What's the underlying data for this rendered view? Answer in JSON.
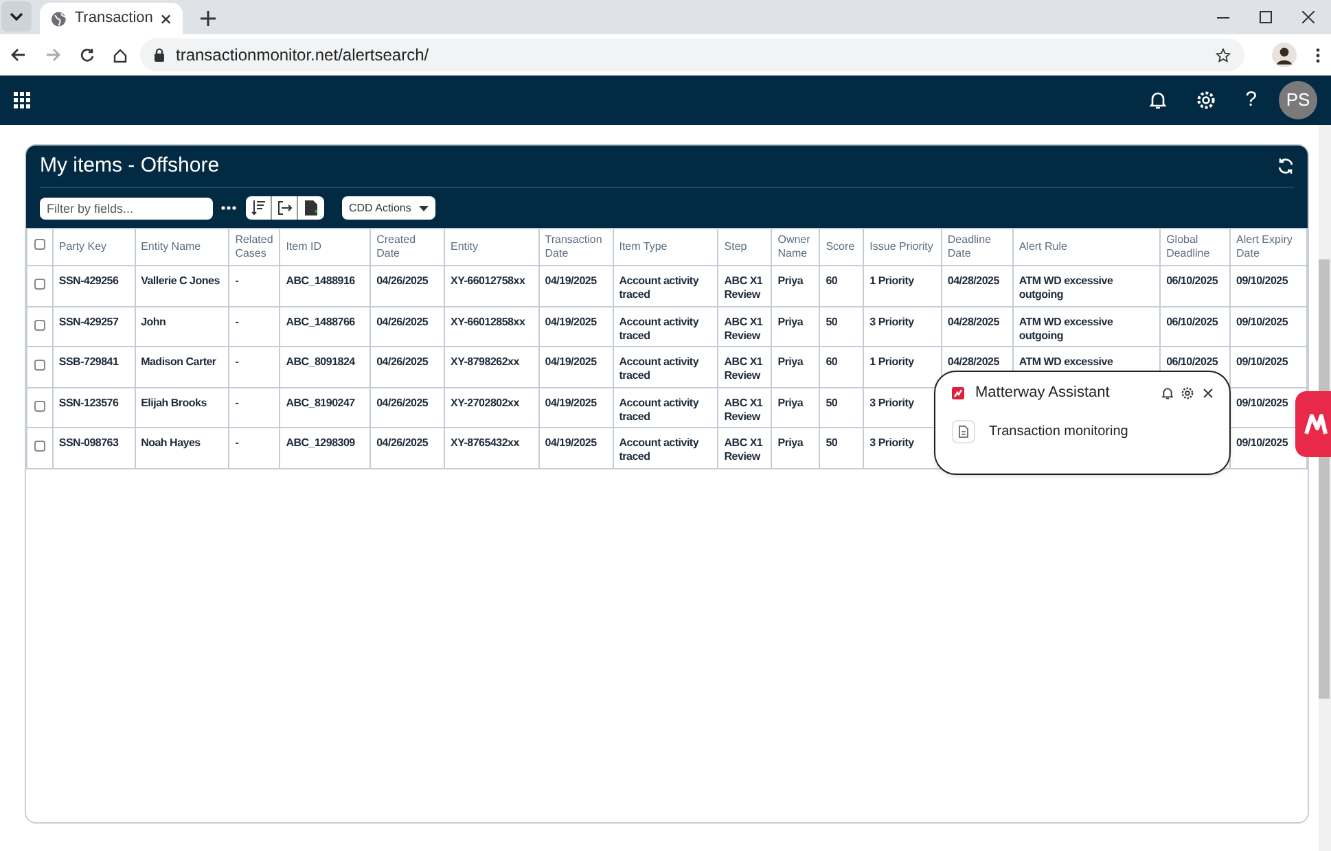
{
  "browser": {
    "tab": {
      "title": "Transaction"
    },
    "url": "transactionmonitor.net/alertsearch/"
  },
  "app_header": {
    "help": "?",
    "avatar": "PS"
  },
  "panel": {
    "title": "My items - Offshore",
    "filter": {
      "placeholder": "Filter by fields..."
    },
    "actions_button": "CDD Actions",
    "table": {
      "select_all_checked": false,
      "columns": [
        "Party Key",
        "Entity Name",
        "Related Cases",
        "Item ID",
        "Created Date",
        "Entity",
        "Transaction Date",
        "Item Type",
        "Step",
        "Owner Name",
        "Score",
        "Issue Priority",
        "Deadline Date",
        "Alert Rule",
        "Global Deadline",
        "Alert Expiry Date"
      ],
      "rows": [
        {
          "checked": false,
          "cells": [
            "SSN-429256",
            "Vallerie C Jones",
            "-",
            "ABC_1488916",
            "04/26/2025",
            "XY-66012758xx",
            "04/19/2025",
            "Account activity traced",
            "ABC X1 Review",
            "Priya",
            "60",
            "1 Priority",
            "04/28/2025",
            "ATM WD excessive outgoing",
            "06/10/2025",
            "09/10/2025"
          ]
        },
        {
          "checked": false,
          "cells": [
            "SSN-429257",
            "John",
            "-",
            "ABC_1488766",
            "04/26/2025",
            "XY-66012858xx",
            "04/19/2025",
            "Account activity traced",
            "ABC X1 Review",
            "Priya",
            "50",
            "3 Priority",
            "04/28/2025",
            "ATM WD excessive outgoing",
            "06/10/2025",
            "09/10/2025"
          ]
        },
        {
          "checked": false,
          "cells": [
            "SSB-729841",
            "Madison Carter",
            "-",
            "ABC_8091824",
            "04/26/2025",
            "XY-8798262xx",
            "04/19/2025",
            "Account activity traced",
            "ABC X1 Review",
            "Priya",
            "60",
            "1 Priority",
            "04/28/2025",
            "ATM WD excessive",
            "06/10/2025",
            "09/10/2025"
          ]
        },
        {
          "checked": false,
          "cells": [
            "SSN-123576",
            "Elijah Brooks",
            "-",
            "ABC_8190247",
            "04/26/2025",
            "XY-2702802xx",
            "04/19/2025",
            "Account activity traced",
            "ABC X1 Review",
            "Priya",
            "50",
            "3 Priority",
            null,
            null,
            null,
            "09/10/2025"
          ]
        },
        {
          "checked": false,
          "cells": [
            "SSN-098763",
            "Noah Hayes",
            "-",
            "ABC_1298309",
            "04/26/2025",
            "XY-8765432xx",
            "04/19/2025",
            "Account activity traced",
            "ABC X1 Review",
            "Priya",
            "50",
            "3 Priority",
            null,
            null,
            null,
            "09/10/2025"
          ]
        }
      ]
    }
  },
  "assistant": {
    "title": "Matterway Assistant",
    "items": [
      "Transaction monitoring"
    ]
  }
}
